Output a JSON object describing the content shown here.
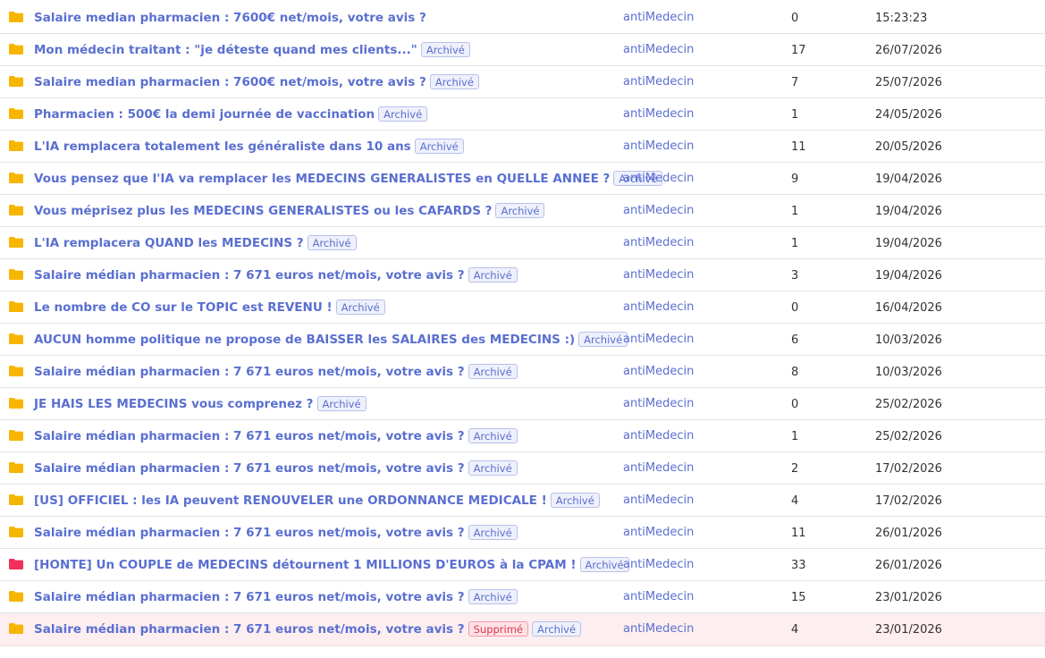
{
  "colors": {
    "folder_default": "#f7b500",
    "folder_hot": "#f0305a",
    "link": "#5a6fd0"
  },
  "labels": {
    "archive": "Archivé",
    "deleted": "Supprimé"
  },
  "topics": [
    {
      "title": "Salaire median pharmacien : 7600€ net/mois, votre avis ?",
      "author": "antiMedecin",
      "replies": "0",
      "date": "15:23:23",
      "archived": false,
      "deleted": false,
      "icon": "folder-icon",
      "icon_color": "#f7b500"
    },
    {
      "title": "Mon médecin traitant : \"je déteste quand mes clients...\"",
      "author": "antiMedecin",
      "replies": "17",
      "date": "26/07/2026",
      "archived": true,
      "deleted": false,
      "icon": "folder-icon",
      "icon_color": "#f7b500"
    },
    {
      "title": "Salaire median pharmacien : 7600€ net/mois, votre avis ?",
      "author": "antiMedecin",
      "replies": "7",
      "date": "25/07/2026",
      "archived": true,
      "deleted": false,
      "icon": "folder-icon",
      "icon_color": "#f7b500"
    },
    {
      "title": "Pharmacien : 500€ la demi journée de vaccination",
      "author": "antiMedecin",
      "replies": "1",
      "date": "24/05/2026",
      "archived": true,
      "deleted": false,
      "icon": "folder-icon",
      "icon_color": "#f7b500"
    },
    {
      "title": "L'IA remplacera totalement les généraliste dans 10 ans",
      "author": "antiMedecin",
      "replies": "11",
      "date": "20/05/2026",
      "archived": true,
      "deleted": false,
      "icon": "folder-icon",
      "icon_color": "#f7b500"
    },
    {
      "title": "Vous pensez que l'IA va remplacer les MEDECINS GENERALISTES en QUELLE ANNEE ?",
      "author": "antiMedecin",
      "replies": "9",
      "date": "19/04/2026",
      "archived": true,
      "deleted": false,
      "icon": "folder-icon",
      "icon_color": "#f7b500"
    },
    {
      "title": "Vous méprisez plus les MEDECINS GENERALISTES ou les CAFARDS ?",
      "author": "antiMedecin",
      "replies": "1",
      "date": "19/04/2026",
      "archived": true,
      "deleted": false,
      "icon": "folder-icon",
      "icon_color": "#f7b500"
    },
    {
      "title": "L'IA remplacera QUAND les MEDECINS ?",
      "author": "antiMedecin",
      "replies": "1",
      "date": "19/04/2026",
      "archived": true,
      "deleted": false,
      "icon": "folder-icon",
      "icon_color": "#f7b500"
    },
    {
      "title": "Salaire médian pharmacien : 7 671 euros net/mois, votre avis ?",
      "author": "antiMedecin",
      "replies": "3",
      "date": "19/04/2026",
      "archived": true,
      "deleted": false,
      "icon": "folder-icon",
      "icon_color": "#f7b500"
    },
    {
      "title": "Le nombre de CO sur le TOPIC est REVENU !",
      "author": "antiMedecin",
      "replies": "0",
      "date": "16/04/2026",
      "archived": true,
      "deleted": false,
      "icon": "folder-icon",
      "icon_color": "#f7b500"
    },
    {
      "title": "AUCUN homme politique ne propose de BAISSER les SALAIRES des MEDECINS :)",
      "author": "antiMedecin",
      "replies": "6",
      "date": "10/03/2026",
      "archived": true,
      "deleted": false,
      "icon": "folder-icon",
      "icon_color": "#f7b500"
    },
    {
      "title": "Salaire médian pharmacien : 7 671 euros net/mois, votre avis ?",
      "author": "antiMedecin",
      "replies": "8",
      "date": "10/03/2026",
      "archived": true,
      "deleted": false,
      "icon": "folder-icon",
      "icon_color": "#f7b500"
    },
    {
      "title": "JE HAIS LES MEDECINS vous comprenez ?",
      "author": "antiMedecin",
      "replies": "0",
      "date": "25/02/2026",
      "archived": true,
      "deleted": false,
      "icon": "folder-icon",
      "icon_color": "#f7b500"
    },
    {
      "title": "Salaire médian pharmacien : 7 671 euros net/mois, votre avis ?",
      "author": "antiMedecin",
      "replies": "1",
      "date": "25/02/2026",
      "archived": true,
      "deleted": false,
      "icon": "folder-icon",
      "icon_color": "#f7b500"
    },
    {
      "title": "Salaire médian pharmacien : 7 671 euros net/mois, votre avis ?",
      "author": "antiMedecin",
      "replies": "2",
      "date": "17/02/2026",
      "archived": true,
      "deleted": false,
      "icon": "folder-icon",
      "icon_color": "#f7b500"
    },
    {
      "title": "[US] OFFICIEL : les IA peuvent RENOUVELER une ORDONNANCE MEDICALE !",
      "author": "antiMedecin",
      "replies": "4",
      "date": "17/02/2026",
      "archived": true,
      "deleted": false,
      "icon": "folder-icon",
      "icon_color": "#f7b500"
    },
    {
      "title": "Salaire médian pharmacien : 7 671 euros net/mois, votre avis ?",
      "author": "antiMedecin",
      "replies": "11",
      "date": "26/01/2026",
      "archived": true,
      "deleted": false,
      "icon": "folder-icon",
      "icon_color": "#f7b500"
    },
    {
      "title": "[HONTE] Un COUPLE de MEDECINS détournent 1 MILLIONS D'EUROS à la CPAM !",
      "author": "antiMedecin",
      "replies": "33",
      "date": "26/01/2026",
      "archived": true,
      "deleted": false,
      "icon": "hot-folder-icon",
      "icon_color": "#f0305a"
    },
    {
      "title": "Salaire médian pharmacien : 7 671 euros net/mois, votre avis ?",
      "author": "antiMedecin",
      "replies": "15",
      "date": "23/01/2026",
      "archived": true,
      "deleted": false,
      "icon": "folder-icon",
      "icon_color": "#f7b500"
    },
    {
      "title": "Salaire médian pharmacien : 7 671 euros net/mois, votre avis ?",
      "author": "antiMedecin",
      "replies": "4",
      "date": "23/01/2026",
      "archived": true,
      "deleted": true,
      "icon": "folder-icon",
      "icon_color": "#f7b500"
    }
  ]
}
